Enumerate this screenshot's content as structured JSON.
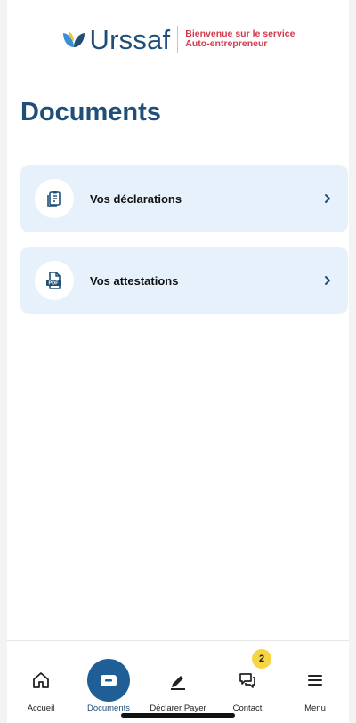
{
  "header": {
    "brand": "Urssaf",
    "tagline_line1": "Bienvenue sur le service",
    "tagline_line2": "Auto-entrepreneur"
  },
  "page": {
    "title": "Documents"
  },
  "cards": [
    {
      "label": "Vos déclarations",
      "icon": "declaration-document-icon"
    },
    {
      "label": "Vos attestations",
      "icon": "pdf-file-icon"
    }
  ],
  "nav": {
    "items": [
      {
        "label": "Accueil",
        "icon": "home-icon"
      },
      {
        "label": "Documents",
        "icon": "folder-icon",
        "active": true
      },
      {
        "label": "Déclarer Payer",
        "icon": "pen-icon"
      },
      {
        "label": "Contact",
        "icon": "chat-icon",
        "badge": "2"
      },
      {
        "label": "Menu",
        "icon": "hamburger-menu-icon"
      }
    ]
  },
  "colors": {
    "brand_blue": "#1f4e79",
    "card_bg": "#e7f1fb",
    "tagline_red": "#d23a4b",
    "badge_yellow": "#f7d444",
    "active_nav_blue": "#1f5e96"
  }
}
